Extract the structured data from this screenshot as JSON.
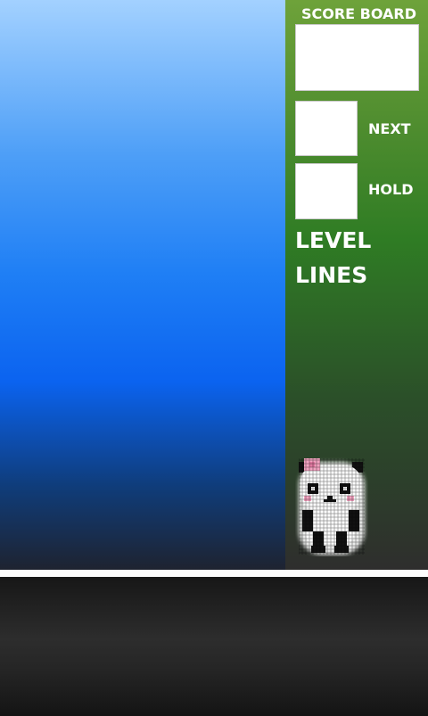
{
  "scoreboard": {
    "title": "SCORE BOARD"
  },
  "next": {
    "label": "NEXT"
  },
  "hold": {
    "label": "HOLD"
  },
  "stats": {
    "level_label": "LEVEL",
    "lines_label": "LINES"
  },
  "mascot": {
    "icon": "panda-icon"
  },
  "colors": {
    "sky_top": "#a3d1ff",
    "sky_mid": "#0b63f0",
    "panel_top": "#6ea23a",
    "panel_bottom": "#2e2e2d",
    "accent_pink": "#f3a3c0"
  }
}
